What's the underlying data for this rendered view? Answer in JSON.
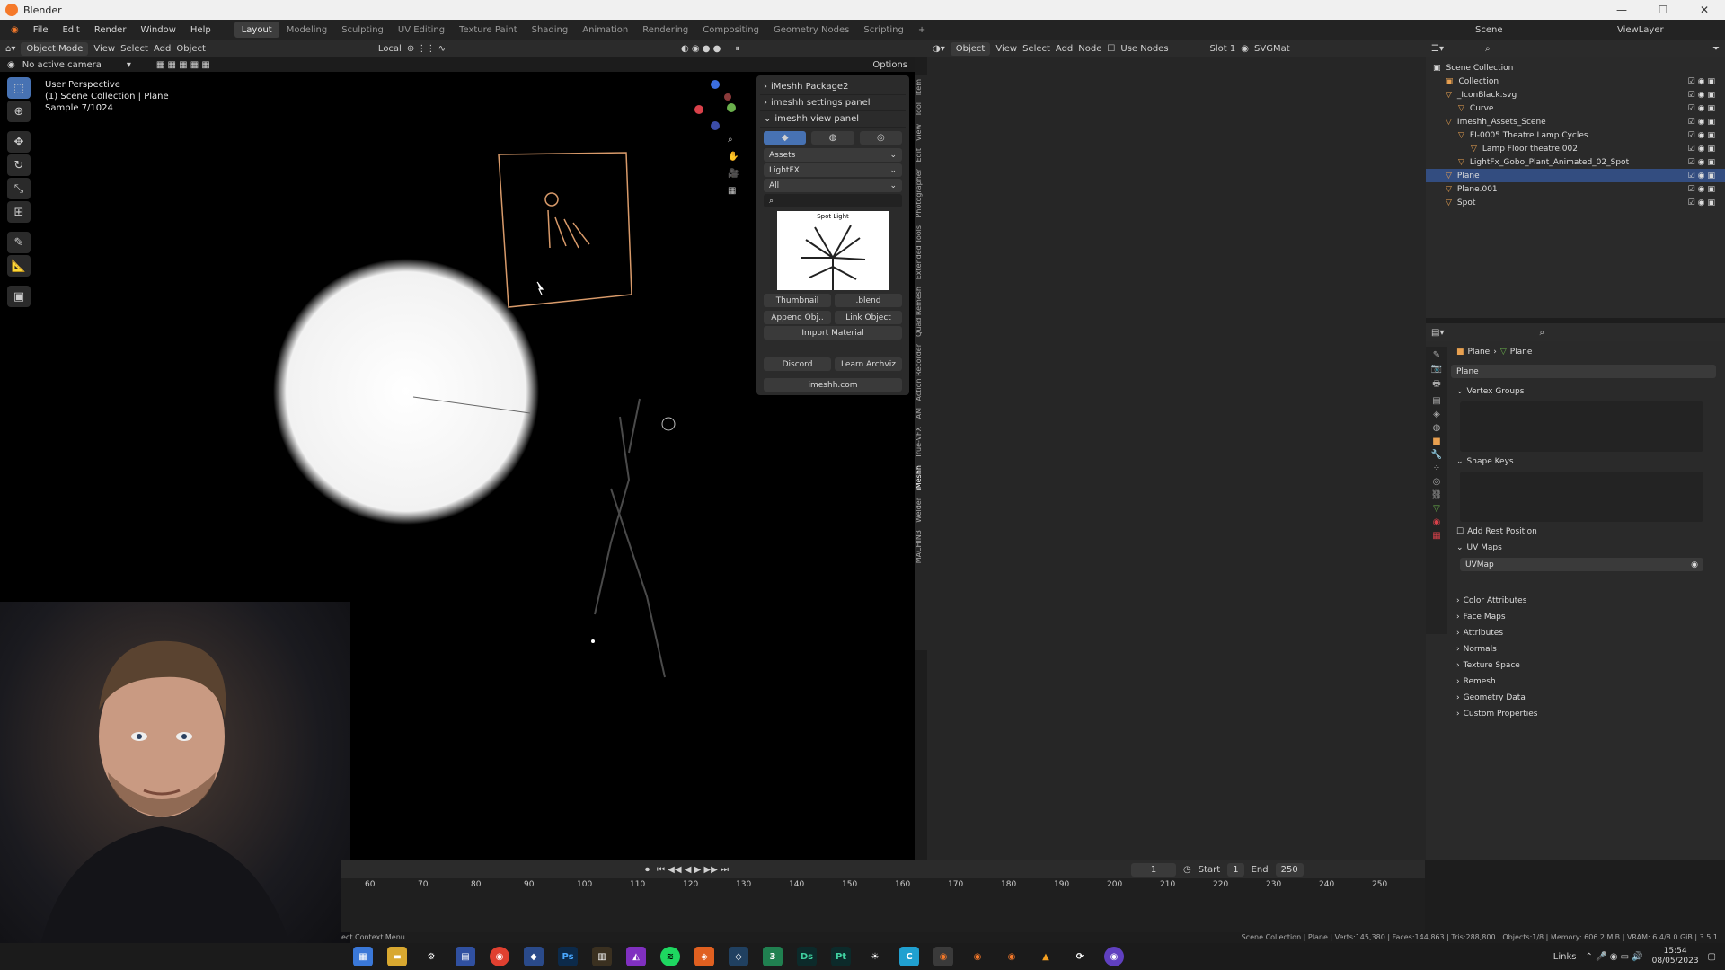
{
  "window": {
    "title": "Blender",
    "controls": [
      "—",
      "☐",
      "✕"
    ]
  },
  "menu": {
    "items": [
      "File",
      "Edit",
      "Render",
      "Window",
      "Help"
    ],
    "workspaces": [
      "Layout",
      "Modeling",
      "Sculpting",
      "UV Editing",
      "Texture Paint",
      "Shading",
      "Animation",
      "Rendering",
      "Compositing",
      "Geometry Nodes",
      "Scripting"
    ],
    "active_workspace": "Layout",
    "add": "+",
    "scene": "Scene",
    "view_layer": "ViewLayer"
  },
  "viewport_header": {
    "mode": "Object Mode",
    "menus": [
      "View",
      "Select",
      "Add",
      "Object"
    ],
    "transform": "Local",
    "options": "Options"
  },
  "viewport_sub": {
    "camera": "No active camera"
  },
  "overlay": {
    "line1": "User Perspective",
    "line2": "(1) Scene Collection | Plane",
    "line3": "Sample 7/1024"
  },
  "imeshh": {
    "p1": "iMeshh Package2",
    "p2": "imeshh settings panel",
    "p3": "imeshh view panel",
    "assets": "Assets",
    "lightfx": "LightFX",
    "all": "All",
    "thumb_label": "Spot Light",
    "thumbnail": "Thumbnail",
    "blend": ".blend",
    "append": "Append Obj..",
    "link": "Link Object",
    "import_mat": "Import Material",
    "discord": "Discord",
    "learn": "Learn Archviz",
    "site": "imeshh.com"
  },
  "vtabs": [
    "Item",
    "Tool",
    "View",
    "Edit",
    "Photographer",
    "Extended Tools",
    "Quad Remesh",
    "Action Recorder",
    "AM",
    "True-VFX",
    "iMeshh",
    "Welder",
    "MACHIN3"
  ],
  "shader_header": {
    "object": "Object",
    "menus": [
      "View",
      "Select",
      "Add",
      "Node"
    ],
    "use_nodes": "Use Nodes",
    "slot": "Slot 1",
    "material": "SVGMat"
  },
  "outliner": {
    "rows": [
      {
        "label": "Scene Collection",
        "indent": 0,
        "sel": false
      },
      {
        "label": "Collection",
        "indent": 1,
        "sel": false
      },
      {
        "label": "_IconBlack.svg",
        "indent": 1,
        "sel": false
      },
      {
        "label": "Curve",
        "indent": 2,
        "sel": false
      },
      {
        "label": "Imeshh_Assets_Scene",
        "indent": 1,
        "sel": false
      },
      {
        "label": "FI-0005 Theatre Lamp Cycles",
        "indent": 2,
        "sel": false
      },
      {
        "label": "Lamp Floor theatre.002",
        "indent": 3,
        "sel": false
      },
      {
        "label": "LightFx_Gobo_Plant_Animated_02_Spot",
        "indent": 2,
        "sel": false
      },
      {
        "label": "Plane",
        "indent": 1,
        "sel": true
      },
      {
        "label": "Plane.001",
        "indent": 1,
        "sel": false
      },
      {
        "label": "Spot",
        "indent": 1,
        "sel": false
      }
    ]
  },
  "props": {
    "crumb1": "Plane",
    "crumb2": "Plane",
    "datablock": "Plane",
    "vertex_groups": "Vertex Groups",
    "shape_keys": "Shape Keys",
    "add_rest": "Add Rest Position",
    "uv_maps": "UV Maps",
    "uvmap": "UVMap",
    "collapsed": [
      "Color Attributes",
      "Face Maps",
      "Attributes",
      "Normals",
      "Texture Space",
      "Remesh",
      "Geometry Data",
      "Custom Properties"
    ]
  },
  "timeline": {
    "frame": "1",
    "start_label": "Start",
    "start": "1",
    "end_label": "End",
    "end": "250",
    "ticks": [
      "60",
      "70",
      "80",
      "90",
      "100",
      "110",
      "120",
      "130",
      "140",
      "150",
      "160",
      "170",
      "180",
      "190",
      "200",
      "210",
      "220",
      "230",
      "240",
      "250"
    ]
  },
  "status": {
    "left": "ect Context Menu",
    "right": "Scene Collection | Plane | Verts:145,380 | Faces:144,863 | Tris:288,800 | Objects:1/8 | Memory: 606.2 MiB | VRAM: 6.4/8.0 GiB | 3.5.1"
  },
  "taskbar": {
    "lang": "Links",
    "time": "15:54",
    "date": "08/05/2023"
  }
}
